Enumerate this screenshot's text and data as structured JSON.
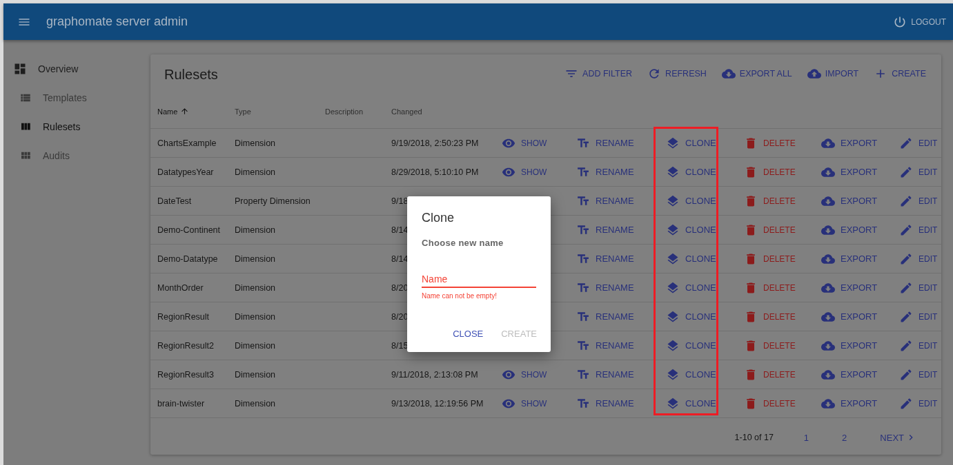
{
  "app_bar": {
    "title": "graphomate server admin",
    "logout": "LOGOUT"
  },
  "sidebar": {
    "items": [
      {
        "label": "Overview",
        "children": [
          {
            "label": "Templates",
            "selected": false
          },
          {
            "label": "Rulesets",
            "selected": true
          },
          {
            "label": "Audits",
            "selected": false
          }
        ]
      }
    ]
  },
  "card": {
    "title": "Rulesets",
    "toolbar": [
      {
        "kind": "filter",
        "label": "ADD FILTER"
      },
      {
        "kind": "refresh",
        "label": "REFRESH"
      },
      {
        "kind": "download",
        "label": "EXPORT ALL"
      },
      {
        "kind": "upload",
        "label": "IMPORT"
      },
      {
        "kind": "add",
        "label": "CREATE"
      }
    ],
    "table": {
      "columns": [
        {
          "label": "Name",
          "sorted": true
        },
        {
          "label": "Type",
          "sorted": false
        },
        {
          "label": "Description",
          "sorted": false
        },
        {
          "label": "Changed",
          "sorted": false
        }
      ],
      "action_columns": [
        {
          "kind": "show",
          "highlighted": false
        },
        {
          "kind": "rename",
          "highlighted": false
        },
        {
          "kind": "clone",
          "highlighted": true
        },
        {
          "kind": "delete",
          "highlighted": false
        },
        {
          "kind": "export",
          "highlighted": false
        },
        {
          "kind": "edit",
          "highlighted": false
        }
      ],
      "rows": [
        {
          "name": "ChartsExample",
          "type": "Dimension",
          "changed": "9/19/2018, 2:50:23 PM",
          "actions": [
            {
              "kind": "show",
              "label": "SHOW"
            },
            {
              "kind": "rename",
              "label": "RENAME"
            },
            {
              "kind": "clone",
              "label": "CLONE"
            },
            {
              "kind": "delete",
              "label": "DELETE"
            },
            {
              "kind": "export",
              "label": "EXPORT"
            },
            {
              "kind": "edit",
              "label": "EDIT"
            }
          ]
        },
        {
          "name": "DatatypesYear",
          "type": "Dimension",
          "changed": "8/29/2018, 5:10:10 PM",
          "actions": [
            {
              "kind": "show",
              "label": "SHOW"
            },
            {
              "kind": "rename",
              "label": "RENAME"
            },
            {
              "kind": "clone",
              "label": "CLONE"
            },
            {
              "kind": "delete",
              "label": "DELETE"
            },
            {
              "kind": "export",
              "label": "EXPORT"
            },
            {
              "kind": "edit",
              "label": "EDIT"
            }
          ]
        },
        {
          "name": "DateTest",
          "type": "Property Dimension",
          "changed": "9/18",
          "actions": [
            {
              "kind": "rename",
              "label": "RENAME"
            },
            {
              "kind": "clone",
              "label": "CLONE"
            },
            {
              "kind": "delete",
              "label": "DELETE"
            },
            {
              "kind": "export",
              "label": "EXPORT"
            },
            {
              "kind": "edit",
              "label": "EDIT"
            }
          ]
        },
        {
          "name": "Demo-Continent",
          "type": "Dimension",
          "changed": "8/14",
          "actions": [
            {
              "kind": "rename",
              "label": "RENAME"
            },
            {
              "kind": "clone",
              "label": "CLONE"
            },
            {
              "kind": "delete",
              "label": "DELETE"
            },
            {
              "kind": "export",
              "label": "EXPORT"
            },
            {
              "kind": "edit",
              "label": "EDIT"
            }
          ]
        },
        {
          "name": "Demo-Datatype",
          "type": "Dimension",
          "changed": "8/14",
          "actions": [
            {
              "kind": "rename",
              "label": "RENAME"
            },
            {
              "kind": "clone",
              "label": "CLONE"
            },
            {
              "kind": "delete",
              "label": "DELETE"
            },
            {
              "kind": "export",
              "label": "EXPORT"
            },
            {
              "kind": "edit",
              "label": "EDIT"
            }
          ]
        },
        {
          "name": "MonthOrder",
          "type": "Dimension",
          "changed": "8/20",
          "actions": [
            {
              "kind": "rename",
              "label": "RENAME"
            },
            {
              "kind": "clone",
              "label": "CLONE"
            },
            {
              "kind": "delete",
              "label": "DELETE"
            },
            {
              "kind": "export",
              "label": "EXPORT"
            },
            {
              "kind": "edit",
              "label": "EDIT"
            }
          ]
        },
        {
          "name": "RegionResult",
          "type": "Dimension",
          "changed": "8/20",
          "actions": [
            {
              "kind": "rename",
              "label": "RENAME"
            },
            {
              "kind": "clone",
              "label": "CLONE"
            },
            {
              "kind": "delete",
              "label": "DELETE"
            },
            {
              "kind": "export",
              "label": "EXPORT"
            },
            {
              "kind": "edit",
              "label": "EDIT"
            }
          ]
        },
        {
          "name": "RegionResult2",
          "type": "Dimension",
          "changed": "8/15",
          "actions": [
            {
              "kind": "rename",
              "label": "RENAME"
            },
            {
              "kind": "clone",
              "label": "CLONE"
            },
            {
              "kind": "delete",
              "label": "DELETE"
            },
            {
              "kind": "export",
              "label": "EXPORT"
            },
            {
              "kind": "edit",
              "label": "EDIT"
            }
          ]
        },
        {
          "name": "RegionResult3",
          "type": "Dimension",
          "changed": "9/11/2018, 2:13:08 PM",
          "actions": [
            {
              "kind": "show",
              "label": "SHOW"
            },
            {
              "kind": "rename",
              "label": "RENAME"
            },
            {
              "kind": "clone",
              "label": "CLONE"
            },
            {
              "kind": "delete",
              "label": "DELETE"
            },
            {
              "kind": "export",
              "label": "EXPORT"
            },
            {
              "kind": "edit",
              "label": "EDIT"
            }
          ]
        },
        {
          "name": "brain-twister",
          "type": "Dimension",
          "changed": "9/13/2018, 12:19:56 PM",
          "actions": [
            {
              "kind": "show",
              "label": "SHOW"
            },
            {
              "kind": "rename",
              "label": "RENAME"
            },
            {
              "kind": "clone",
              "label": "CLONE"
            },
            {
              "kind": "delete",
              "label": "DELETE"
            },
            {
              "kind": "export",
              "label": "EXPORT"
            },
            {
              "kind": "edit",
              "label": "EDIT"
            }
          ]
        }
      ]
    },
    "pagination": {
      "range": "1-10 of 17",
      "pages": [
        "1",
        "2"
      ],
      "next": "NEXT"
    }
  },
  "dialog": {
    "title": "Clone",
    "prompt": "Choose new name",
    "field": {
      "placeholder": "Name",
      "error": "Name can not be empty!"
    },
    "buttons": [
      {
        "label": "CLOSE",
        "disabled": false
      },
      {
        "label": "CREATE",
        "disabled": true
      }
    ]
  }
}
